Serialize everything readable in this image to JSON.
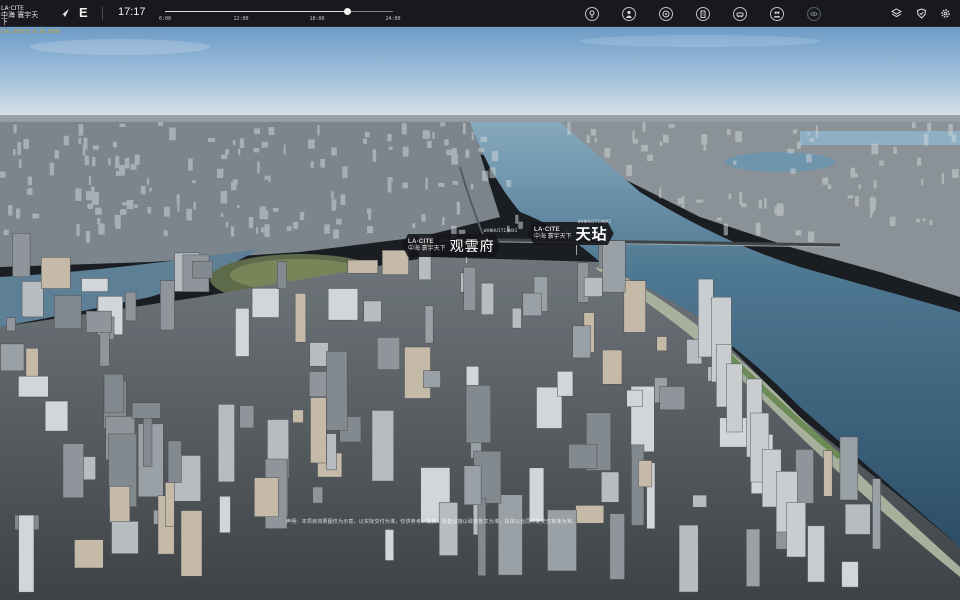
{
  "app": {
    "brand_line1": "LA·CITE",
    "brand_line2": "中海 寰宇天下",
    "compass_letter": "E",
    "time": "17:17",
    "coordinates": "114.261073 N:30.5800"
  },
  "timeline": {
    "ticks": [
      "6:00",
      "12:00",
      "18:00",
      "24:00"
    ],
    "progress": 0.8
  },
  "toolbar": {
    "tools": [
      {
        "icon": "location-icon",
        "label": "location"
      },
      {
        "icon": "person-icon",
        "label": "person"
      },
      {
        "icon": "compass-target-icon",
        "label": "target"
      },
      {
        "icon": "building-icon",
        "label": "building"
      },
      {
        "icon": "car-icon",
        "label": "traffic"
      },
      {
        "icon": "people-icon",
        "label": "people"
      },
      {
        "icon": "eye-icon",
        "label": "view"
      }
    ],
    "right": [
      {
        "icon": "layers-icon"
      },
      {
        "icon": "shield-icon"
      },
      {
        "icon": "gear-icon"
      }
    ]
  },
  "scene": {
    "labels": [
      {
        "tag_top": "LA·CITE",
        "tag_bottom": "中海 寰宇天下",
        "name": "观雲府",
        "sub": "WANHUITIANXI"
      },
      {
        "tag_top": "LA·CITE",
        "tag_bottom": "中海 寰宇天下",
        "name": "天玷",
        "sub": "WANHUITIANXI"
      }
    ],
    "disclaimer": "声明：本项目效果图仅为示意，以实际交付为准，仅供参考，交房、配套设施以政府批文为准，具体以合同约定交付标准为准。",
    "colors": {
      "sky_top": "#6d9bc7",
      "sky_horizon": "#dfe7ec",
      "river": "#3f6a86",
      "bar": "#17191d"
    }
  }
}
